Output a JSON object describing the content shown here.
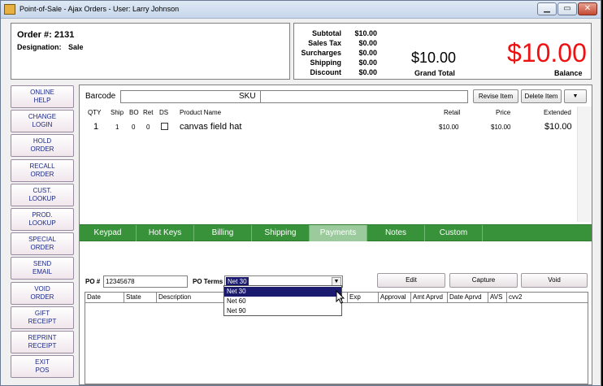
{
  "window": {
    "title": "Point-of-Sale - Ajax Orders - User: Larry Johnson",
    "controls": {
      "minimize": "▁",
      "maximize": "▭",
      "close": "✕"
    }
  },
  "order": {
    "number_label": "Order #: 2131",
    "designation_label": "Designation:",
    "designation_value": "Sale"
  },
  "totals": {
    "subtotal_label": "Subtotal",
    "subtotal_value": "$10.00",
    "tax_label": "Sales Tax",
    "tax_value": "$0.00",
    "surcharges_label": "Surcharges",
    "surcharges_value": "$0.00",
    "shipping_label": "Shipping",
    "shipping_value": "$0.00",
    "discount_label": "Discount",
    "discount_value": "$0.00",
    "grand_total_value": "$10.00",
    "grand_total_label": "Grand Total",
    "balance_value": "$10.00",
    "balance_label": "Balance",
    "balance_color": "#ee1111"
  },
  "sidebar": {
    "buttons": [
      "ONLINE\nHELP",
      "CHANGE\nLOGIN",
      "HOLD\nORDER",
      "RECALL\nORDER",
      "CUST.\nLOOKUP",
      "PROD.\nLOOKUP",
      "SPECIAL\nORDER",
      "SEND\nEMAIL",
      "VOID\nORDER",
      "GIFT\nRECEIPT",
      "REPRINT\nRECEIPT",
      "EXIT\nPOS"
    ]
  },
  "entry": {
    "barcode_label": "Barcode",
    "sku_label": "SKU",
    "revise_label": "Revise Item",
    "delete_label": "Delete Item",
    "dropdown_icon": "▼"
  },
  "items": {
    "columns": {
      "qty": "QTY",
      "ship": "Ship",
      "bo": "BO",
      "ret": "Ret",
      "ds": "DS",
      "product": "Product Name",
      "retail": "Retail",
      "price": "Price",
      "extended": "Extended"
    },
    "row": {
      "qty": "1",
      "ship": "1",
      "bo": "0",
      "ret": "0",
      "product": "canvas field hat",
      "retail": "$10.00",
      "price": "$10.00",
      "extended": "$10.00"
    }
  },
  "tabs": [
    "Keypad",
    "Hot Keys",
    "Billing",
    "Shipping",
    "Payments",
    "Notes",
    "Custom"
  ],
  "tab_colors": {
    "bar": "#37923a",
    "active": "#9bcb9d"
  },
  "payments": {
    "po_label": "PO #",
    "po_value": "12345678",
    "po_terms_label": "PO Terms",
    "po_terms_selected": "Net 30",
    "terms_options": [
      "Net 30",
      "Net 60",
      "Net 90"
    ],
    "edit_label": "Edit",
    "capture_label": "Capture",
    "void_label": "Void",
    "grid_columns": [
      "Date",
      "State",
      "Description",
      "Exp",
      "Approval",
      "Amt Aprvd",
      "Date Aprvd",
      "AVS",
      "cvv2"
    ]
  }
}
